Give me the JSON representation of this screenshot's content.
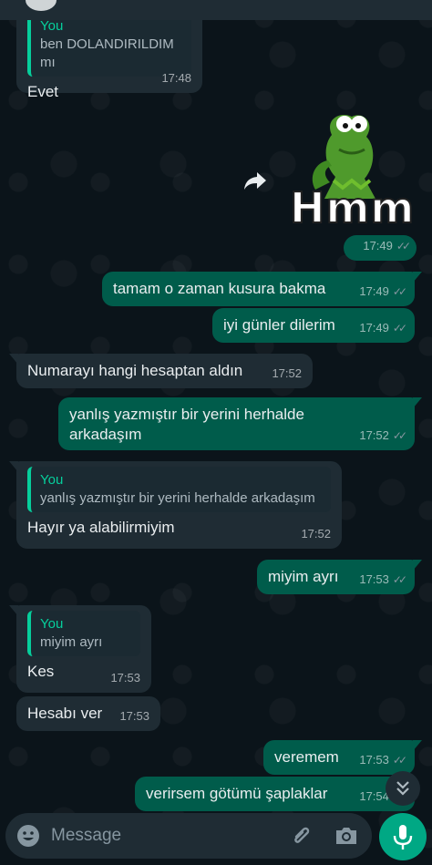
{
  "chat": {
    "messages": [
      {
        "dir": "in",
        "quote_name": "You",
        "quote_text": "ben DOLANDIRILDIM mı",
        "text": "Evet",
        "time": "17:48"
      },
      {
        "dir": "out",
        "sticker": "Hmm",
        "sticker_character": "kermit-the-frog",
        "time": "17:49"
      },
      {
        "dir": "out",
        "text": "tamam o zaman kusura bakma",
        "time": "17:49"
      },
      {
        "dir": "out",
        "text": "iyi günler dilerim",
        "time": "17:49"
      },
      {
        "dir": "in",
        "text": "Numarayı hangi hesaptan aldın",
        "time": "17:52"
      },
      {
        "dir": "out",
        "text_line1": "yanlış yazmıştır bir yerini herhalde",
        "text_line2": "arkadaşım",
        "time": "17:52"
      },
      {
        "dir": "in",
        "quote_name": "You",
        "quote_text": "yanlış yazmıştır bir yerini herhalde arkadaşım",
        "text": "Hayır ya alabilirmiyim",
        "time": "17:52"
      },
      {
        "dir": "out",
        "text": "miyim ayrı",
        "time": "17:53"
      },
      {
        "dir": "in",
        "quote_name": "You",
        "quote_text": "miyim ayrı",
        "text": "Kes",
        "time": "17:53"
      },
      {
        "dir": "in",
        "text": "Hesabı ver",
        "time": "17:53"
      },
      {
        "dir": "out",
        "text": "veremem",
        "time": "17:53"
      },
      {
        "dir": "out",
        "text": "verirsem götümü şaplaklar",
        "time": "17:54"
      }
    ]
  },
  "composer": {
    "placeholder": "Message",
    "icons": [
      "emoji-icon",
      "attach-icon",
      "camera-icon",
      "mic-icon"
    ]
  },
  "colors": {
    "background": "#0b141a",
    "incoming": "#1f2c34",
    "outgoing": "#005c4b",
    "accent": "#06cf9c",
    "mic_button": "#00a884"
  }
}
